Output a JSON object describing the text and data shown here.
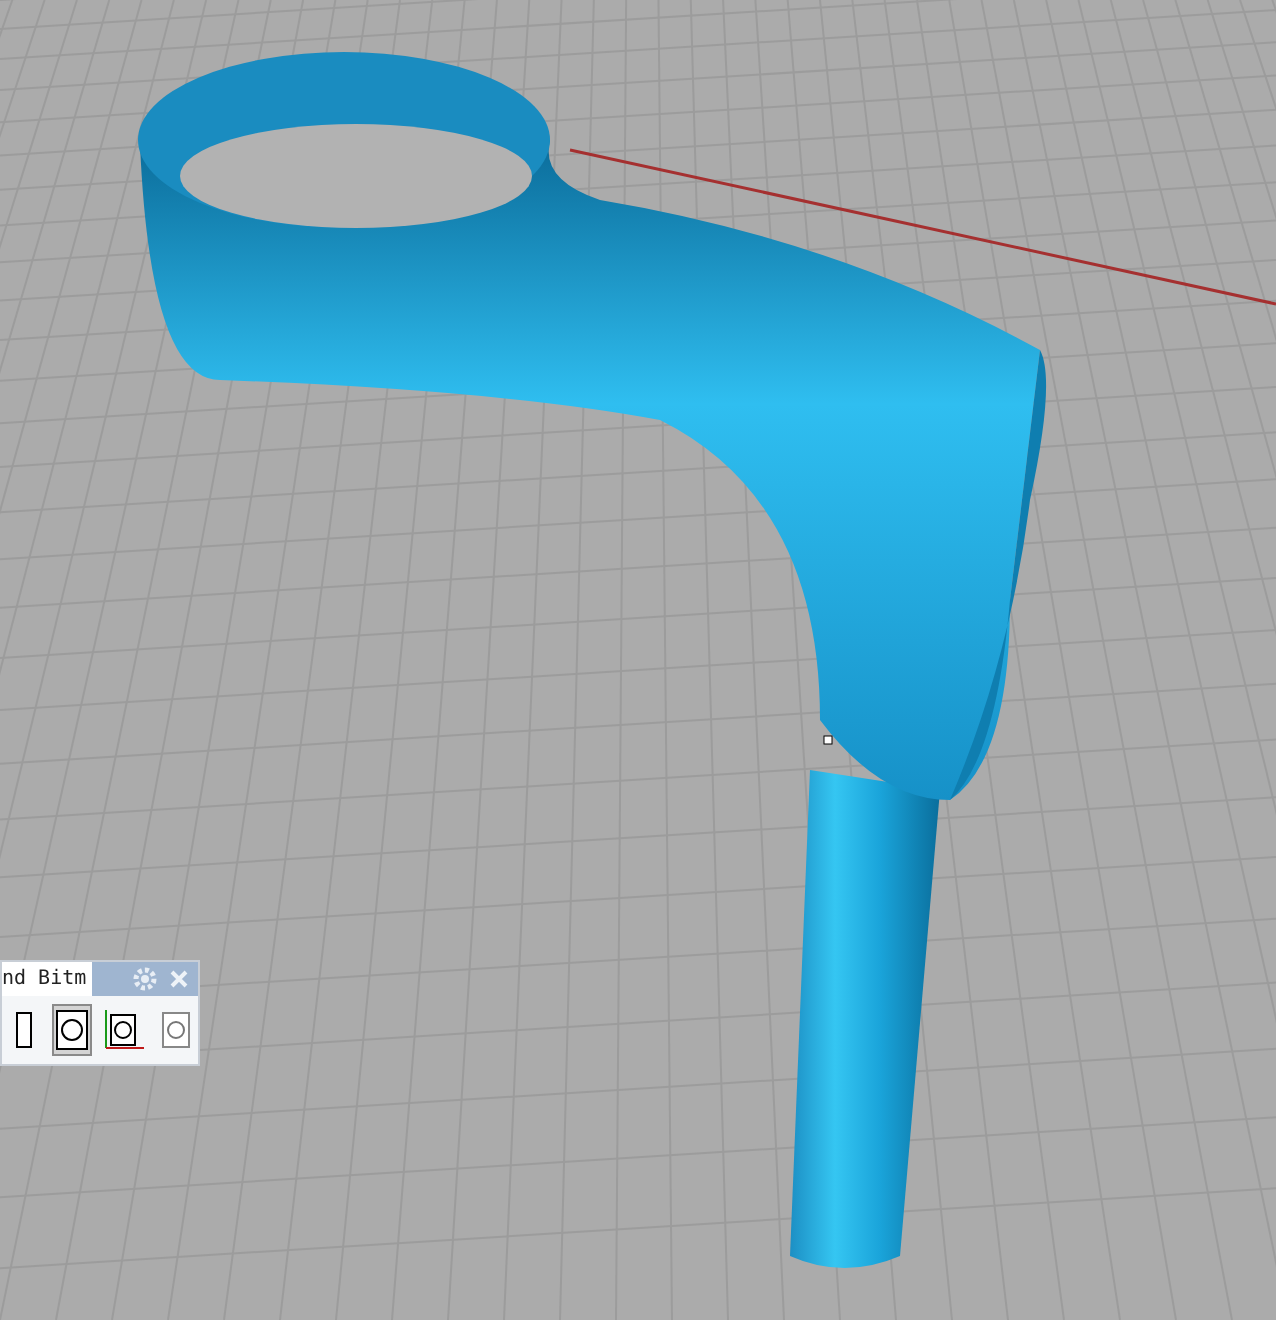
{
  "panel": {
    "title": "nd Bitm",
    "tools": [
      {
        "kind": "frame",
        "selected": false
      },
      {
        "kind": "face",
        "selected": true
      },
      {
        "kind": "face-axes",
        "selected": false
      },
      {
        "kind": "face-faded",
        "selected": false
      }
    ]
  }
}
